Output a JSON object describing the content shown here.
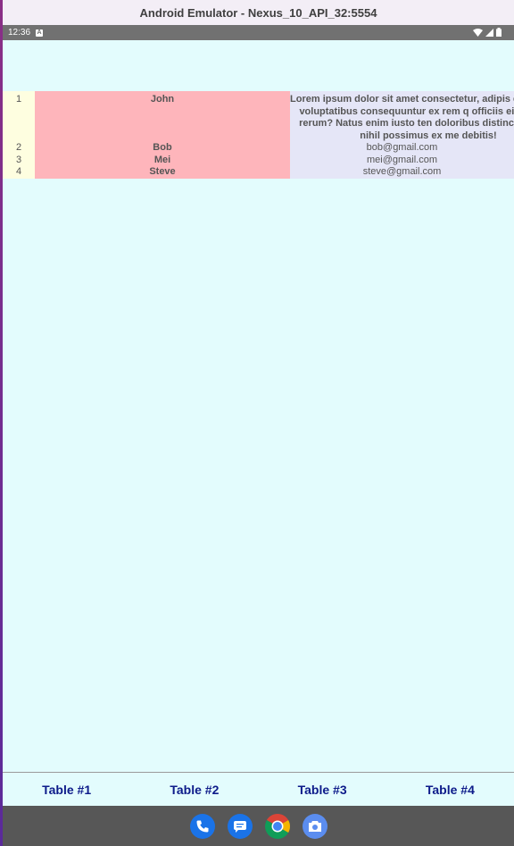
{
  "window": {
    "title": "Android Emulator - Nexus_10_API_32:5554"
  },
  "status_bar": {
    "time": "12:36",
    "notification_glyph": "A"
  },
  "table": {
    "rows": [
      {
        "id": "1",
        "name": "John",
        "email": "Lorem ipsum dolor sit amet consectetur, adipis elit. Mollitia voluptatibus consequuntur ex rem q officiis eius facere rerum? Natus enim iusto ten doloribus distinctio facere nihil possimus ex me debitis!"
      },
      {
        "id": "2",
        "name": "Bob",
        "email": "bob@gmail.com"
      },
      {
        "id": "3",
        "name": "Mei",
        "email": "mei@gmail.com"
      },
      {
        "id": "4",
        "name": "Steve",
        "email": "steve@gmail.com"
      }
    ]
  },
  "tabs": [
    "Table #1",
    "Table #2",
    "Table #3",
    "Table #4"
  ],
  "dock": [
    "phone-icon",
    "messages-icon",
    "chrome-icon",
    "camera-icon"
  ],
  "colors": {
    "background": "#e3fcfd",
    "id_column": "#fefee0",
    "name_column": "#feb5bb",
    "email_column": "#e5e6f7",
    "tab_text": "#0d1b8a",
    "nav_bar": "#575757"
  }
}
